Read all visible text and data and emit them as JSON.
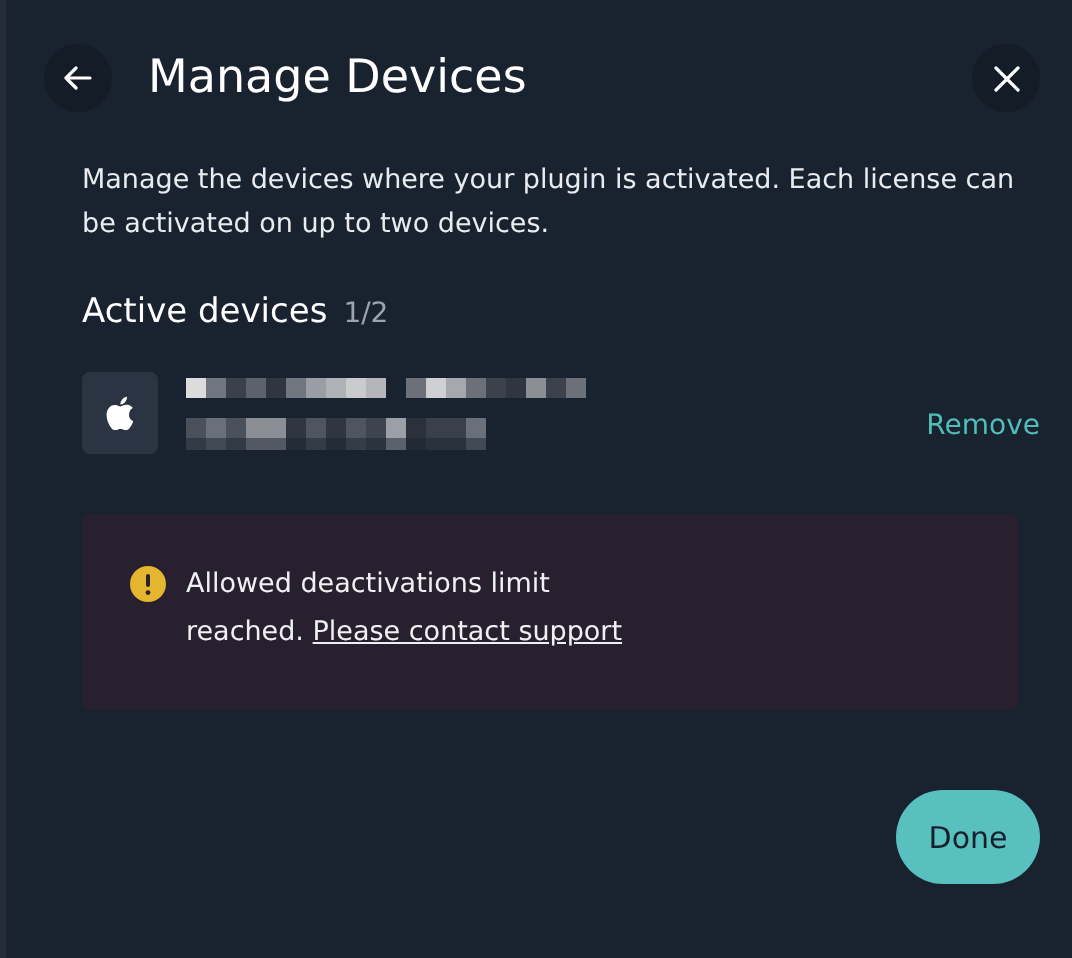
{
  "dialog": {
    "title": "Manage Devices",
    "description": "Manage the devices where your plugin is activated. Each license can be activated on up to two devices."
  },
  "active_devices": {
    "heading": "Active devices",
    "count": "1/2",
    "devices": [
      {
        "action": "Remove"
      }
    ]
  },
  "alert": {
    "message": "Allowed deactivations limit reached.",
    "link": "Please contact support"
  },
  "buttons": {
    "done": "Done"
  }
}
